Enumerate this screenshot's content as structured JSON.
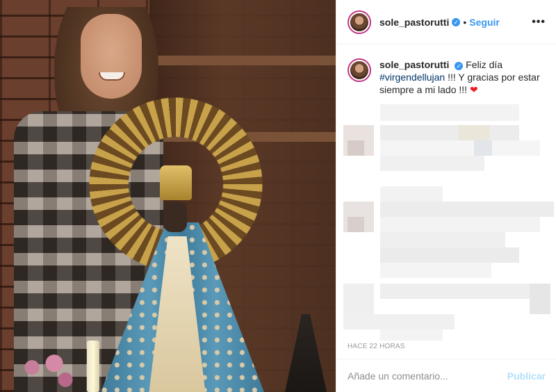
{
  "post": {
    "username": "sole_pastorutti",
    "follow_label": "Seguir",
    "separator": "•",
    "more_label": "•••",
    "verified_glyph": "✓"
  },
  "caption": {
    "username": "sole_pastorutti",
    "text_before": "Feliz día",
    "hashtag": "#virgendellujan",
    "text_after": "!!! Y gracias por estar siempre a mi lado !!!",
    "heart": "❤"
  },
  "timestamp": "HACE 22 HORAS",
  "comment_box": {
    "placeholder": "Añade un comentario...",
    "publish_label": "Publicar"
  },
  "icons": {
    "verified": "verified-badge-icon",
    "more": "more-options-icon",
    "heart": "heart-emoji-icon"
  },
  "colors": {
    "link": "#3897f0",
    "hashtag": "#003569",
    "publish_disabled": "#b2dffc",
    "avatar_ring": "#c13584"
  }
}
